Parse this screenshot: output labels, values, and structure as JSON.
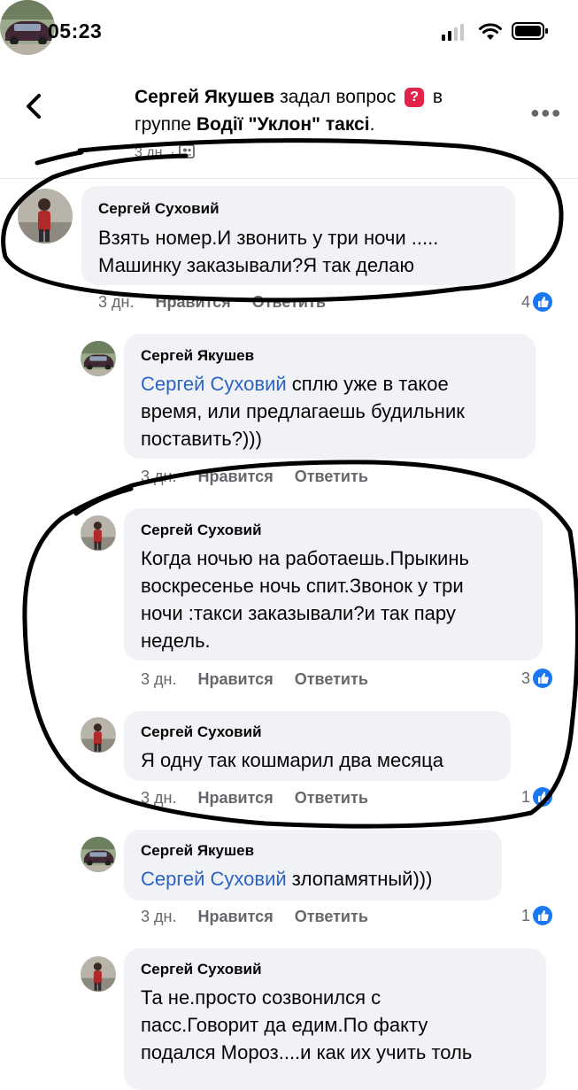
{
  "status_bar": {
    "time": "05:23"
  },
  "post": {
    "author": "Сергей Якушев",
    "action": "задал вопрос",
    "preposition": "в",
    "group_prefix": "группе",
    "group_name": "Водії \"Уклон\" таксі",
    "question_icon": "?",
    "time": "3 дн."
  },
  "comments": [
    {
      "name": "Сергей Суховий",
      "mention": "",
      "lines": [
        "Взять номер.И звонить у три ночи .....",
        "Машинку заказывали?Я так делаю"
      ],
      "time": "3 дн.",
      "like": "Нравится",
      "reply": "Ответить",
      "reactions": "4"
    },
    {
      "name": "Сергей Якушев",
      "mention": "Сергей Суховий",
      "lines": [
        " сплю уже в такое",
        "время, или предлагаешь будильник",
        "поставить?)))"
      ],
      "time": "3 дн.",
      "like": "Нравится",
      "reply": "Ответить",
      "reactions": ""
    },
    {
      "name": "Сергей Суховий",
      "mention": "",
      "lines": [
        "Когда ночью на работаешь.Прыкинь",
        "воскресенье ночь спит.Звонок у три",
        "ночи :такси заказывали?и так пару",
        "недель."
      ],
      "time": "3 дн.",
      "like": "Нравится",
      "reply": "Ответить",
      "reactions": "3"
    },
    {
      "name": "Сергей Суховий",
      "mention": "",
      "lines": [
        "Я одну так кошмарил два месяца"
      ],
      "time": "3 дн.",
      "like": "Нравится",
      "reply": "Ответить",
      "reactions": "1"
    },
    {
      "name": "Сергей Якушев",
      "mention": "Сергей Суховий",
      "lines": [
        " злопамятный)))"
      ],
      "time": "3 дн.",
      "like": "Нравится",
      "reply": "Ответить",
      "reactions": "1"
    },
    {
      "name": "Сергей Суховий",
      "mention": "",
      "lines": [
        "Та не.просто созвонился с",
        "пасс.Говорит да едим.По факту",
        "подался Мороз....и как их учить толь"
      ],
      "time": "",
      "like": "",
      "reply": "",
      "reactions": ""
    }
  ],
  "colors": {
    "like_blue": "#1877f2",
    "mention": "#2c64c6",
    "bubble": "#f0f2f5",
    "meta": "#65676b"
  }
}
